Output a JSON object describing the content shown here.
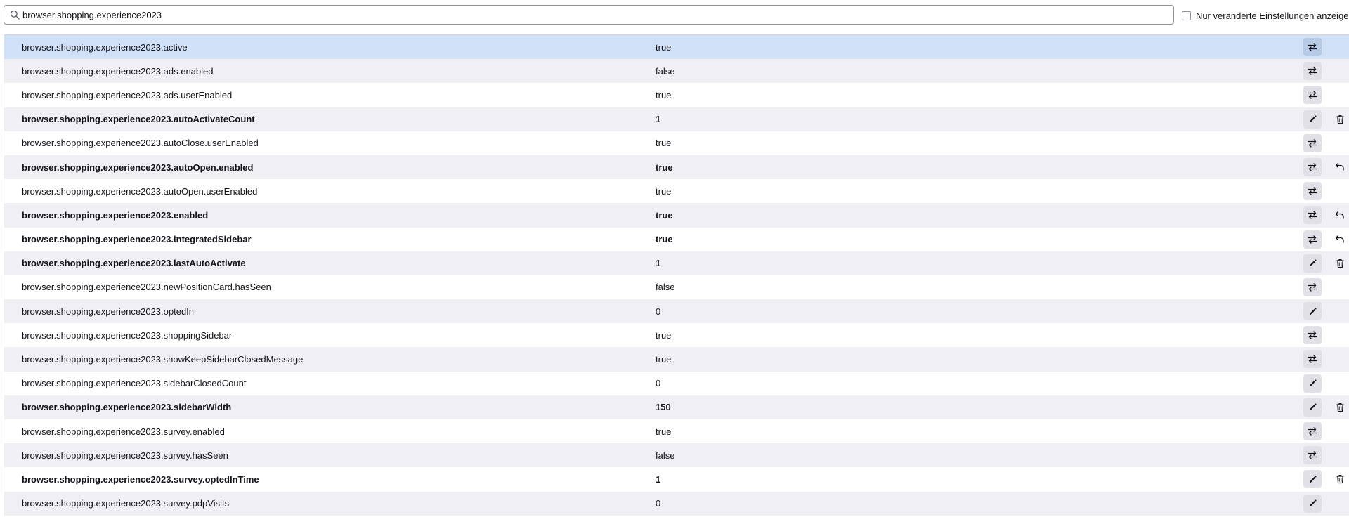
{
  "search": {
    "value": "browser.shopping.experience2023",
    "icon": "search-icon"
  },
  "filter": {
    "label": "Nur veränderte Einstellungen anzeigen",
    "checked": false
  },
  "colors": {
    "selected_row": "#cfe0f7",
    "odd_row": "#f0f0f4",
    "button_bg": "#e0e0e6"
  },
  "prefs": [
    {
      "name": "browser.shopping.experience2023.active",
      "value": "true",
      "modified": false,
      "action": "toggle",
      "reset": "none",
      "selected": true
    },
    {
      "name": "browser.shopping.experience2023.ads.enabled",
      "value": "false",
      "modified": false,
      "action": "toggle",
      "reset": "none"
    },
    {
      "name": "browser.shopping.experience2023.ads.userEnabled",
      "value": "true",
      "modified": false,
      "action": "toggle",
      "reset": "none"
    },
    {
      "name": "browser.shopping.experience2023.autoActivateCount",
      "value": "1",
      "modified": true,
      "action": "edit",
      "reset": "delete"
    },
    {
      "name": "browser.shopping.experience2023.autoClose.userEnabled",
      "value": "true",
      "modified": false,
      "action": "toggle",
      "reset": "none"
    },
    {
      "name": "browser.shopping.experience2023.autoOpen.enabled",
      "value": "true",
      "modified": true,
      "action": "toggle",
      "reset": "reset"
    },
    {
      "name": "browser.shopping.experience2023.autoOpen.userEnabled",
      "value": "true",
      "modified": false,
      "action": "toggle",
      "reset": "none"
    },
    {
      "name": "browser.shopping.experience2023.enabled",
      "value": "true",
      "modified": true,
      "action": "toggle",
      "reset": "reset"
    },
    {
      "name": "browser.shopping.experience2023.integratedSidebar",
      "value": "true",
      "modified": true,
      "action": "toggle",
      "reset": "reset"
    },
    {
      "name": "browser.shopping.experience2023.lastAutoActivate",
      "value": "1",
      "modified": true,
      "action": "edit",
      "reset": "delete"
    },
    {
      "name": "browser.shopping.experience2023.newPositionCard.hasSeen",
      "value": "false",
      "modified": false,
      "action": "toggle",
      "reset": "none"
    },
    {
      "name": "browser.shopping.experience2023.optedIn",
      "value": "0",
      "modified": false,
      "action": "edit",
      "reset": "none"
    },
    {
      "name": "browser.shopping.experience2023.shoppingSidebar",
      "value": "true",
      "modified": false,
      "action": "toggle",
      "reset": "none"
    },
    {
      "name": "browser.shopping.experience2023.showKeepSidebarClosedMessage",
      "value": "true",
      "modified": false,
      "action": "toggle",
      "reset": "none"
    },
    {
      "name": "browser.shopping.experience2023.sidebarClosedCount",
      "value": "0",
      "modified": false,
      "action": "edit",
      "reset": "none"
    },
    {
      "name": "browser.shopping.experience2023.sidebarWidth",
      "value": "150",
      "modified": true,
      "action": "edit",
      "reset": "delete"
    },
    {
      "name": "browser.shopping.experience2023.survey.enabled",
      "value": "true",
      "modified": false,
      "action": "toggle",
      "reset": "none"
    },
    {
      "name": "browser.shopping.experience2023.survey.hasSeen",
      "value": "false",
      "modified": false,
      "action": "toggle",
      "reset": "none"
    },
    {
      "name": "browser.shopping.experience2023.survey.optedInTime",
      "value": "1",
      "modified": true,
      "action": "edit",
      "reset": "delete"
    },
    {
      "name": "browser.shopping.experience2023.survey.pdpVisits",
      "value": "0",
      "modified": false,
      "action": "edit",
      "reset": "none"
    }
  ]
}
